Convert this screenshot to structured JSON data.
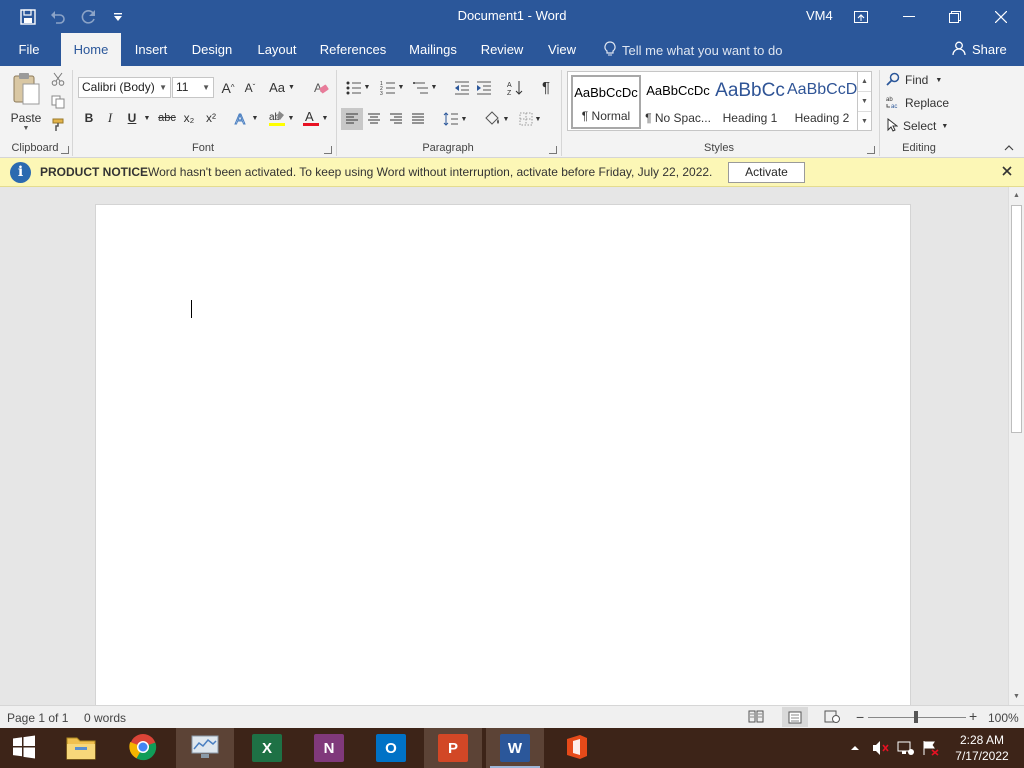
{
  "window": {
    "title": "Document1 - Word",
    "user": "VM4"
  },
  "tabs": {
    "file": "File",
    "home": "Home",
    "insert": "Insert",
    "design": "Design",
    "layout": "Layout",
    "references": "References",
    "mailings": "Mailings",
    "review": "Review",
    "view": "View",
    "tell_me": "Tell me what you want to do",
    "share": "Share"
  },
  "ribbon": {
    "clipboard": {
      "label": "Clipboard",
      "paste": "Paste"
    },
    "font": {
      "label": "Font",
      "font_name": "Calibri (Body)",
      "font_size": "11",
      "change_case": "Aa",
      "bold": "B",
      "italic": "I",
      "underline": "U",
      "strikethrough": "abc",
      "subscript": "x₂",
      "superscript": "x²",
      "font_color": "#e81123",
      "highlight_color": "#ffff00"
    },
    "paragraph": {
      "label": "Paragraph"
    },
    "styles": {
      "label": "Styles",
      "items": [
        {
          "sample": "AaBbCcDc",
          "name": "¶ Normal"
        },
        {
          "sample": "AaBbCcDc",
          "name": "¶ No Spac..."
        },
        {
          "sample": "AaBbCc",
          "name": "Heading 1"
        },
        {
          "sample": "AaBbCcD",
          "name": "Heading 2"
        }
      ]
    },
    "editing": {
      "label": "Editing",
      "find": "Find",
      "replace": "Replace",
      "select": "Select"
    }
  },
  "notice": {
    "label": "PRODUCT NOTICE",
    "message": "Word hasn't been activated. To keep using Word without interruption, activate before Friday, July 22, 2022.",
    "button": "Activate"
  },
  "status": {
    "page": "Page 1 of 1",
    "words": "0 words",
    "zoom": "100%",
    "zoom_level_percent": 100
  },
  "taskbar": {
    "apps": [
      {
        "name": "file-explorer",
        "letter": ""
      },
      {
        "name": "chrome",
        "letter": ""
      },
      {
        "name": "resource-monitor",
        "letter": ""
      },
      {
        "name": "excel",
        "letter": "X",
        "color": "#1e7145"
      },
      {
        "name": "onenote",
        "letter": "N",
        "color": "#80397b"
      },
      {
        "name": "outlook",
        "letter": "O",
        "color": "#0072c6"
      },
      {
        "name": "powerpoint",
        "letter": "P",
        "color": "#d24726"
      },
      {
        "name": "word",
        "letter": "W",
        "color": "#2b579a"
      },
      {
        "name": "office",
        "letter": "",
        "color": "#e64a19"
      }
    ],
    "time": "2:28 AM",
    "date": "7/17/2022"
  },
  "colors": {
    "word_blue": "#2b579a",
    "notice_bg": "#fcf7b6",
    "taskbar_bg": "#3d2418"
  }
}
